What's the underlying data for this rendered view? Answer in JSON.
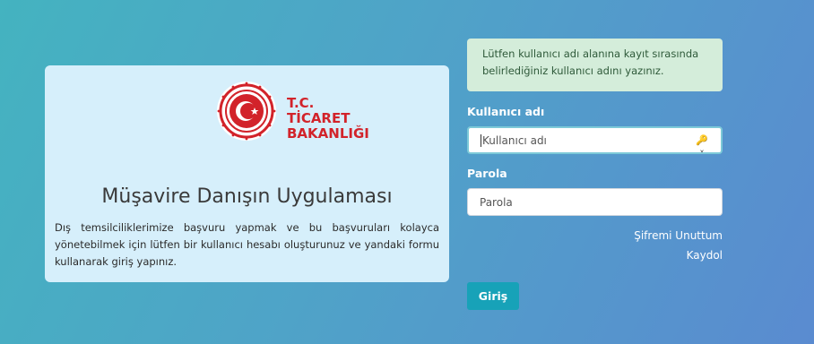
{
  "colors": {
    "brand_red": "#d2232a",
    "accent": "#17a2b8",
    "alert_bg": "#d4edda"
  },
  "logo": {
    "line1": "T.C. TİCARET",
    "line2": "BAKANLIĞI",
    "emblem_icon": "turkish-emblem-icon"
  },
  "info": {
    "title": "Müşavire Danışın Uygulaması",
    "description": "Dış temsilciliklerimize başvuru yapmak ve bu başvuruları kolayca yönetebilmek için lütfen bir kullanıcı hesabı oluşturunuz ve yandaki formu kullanarak giriş yapınız."
  },
  "alert": {
    "text": "Lütfen kullanıcı adı alanına kayıt sırasında belirlediğiniz kullanıcı adını yazınız."
  },
  "form": {
    "username_label": "Kullanıcı adı",
    "username_placeholder": "Kullanıcı adı",
    "username_value": "",
    "password_label": "Parola",
    "password_placeholder": "Parola",
    "password_value": "",
    "forgot_link": "Şifremi Unuttum",
    "register_link": "Kaydol",
    "submit_label": "Giriş"
  }
}
